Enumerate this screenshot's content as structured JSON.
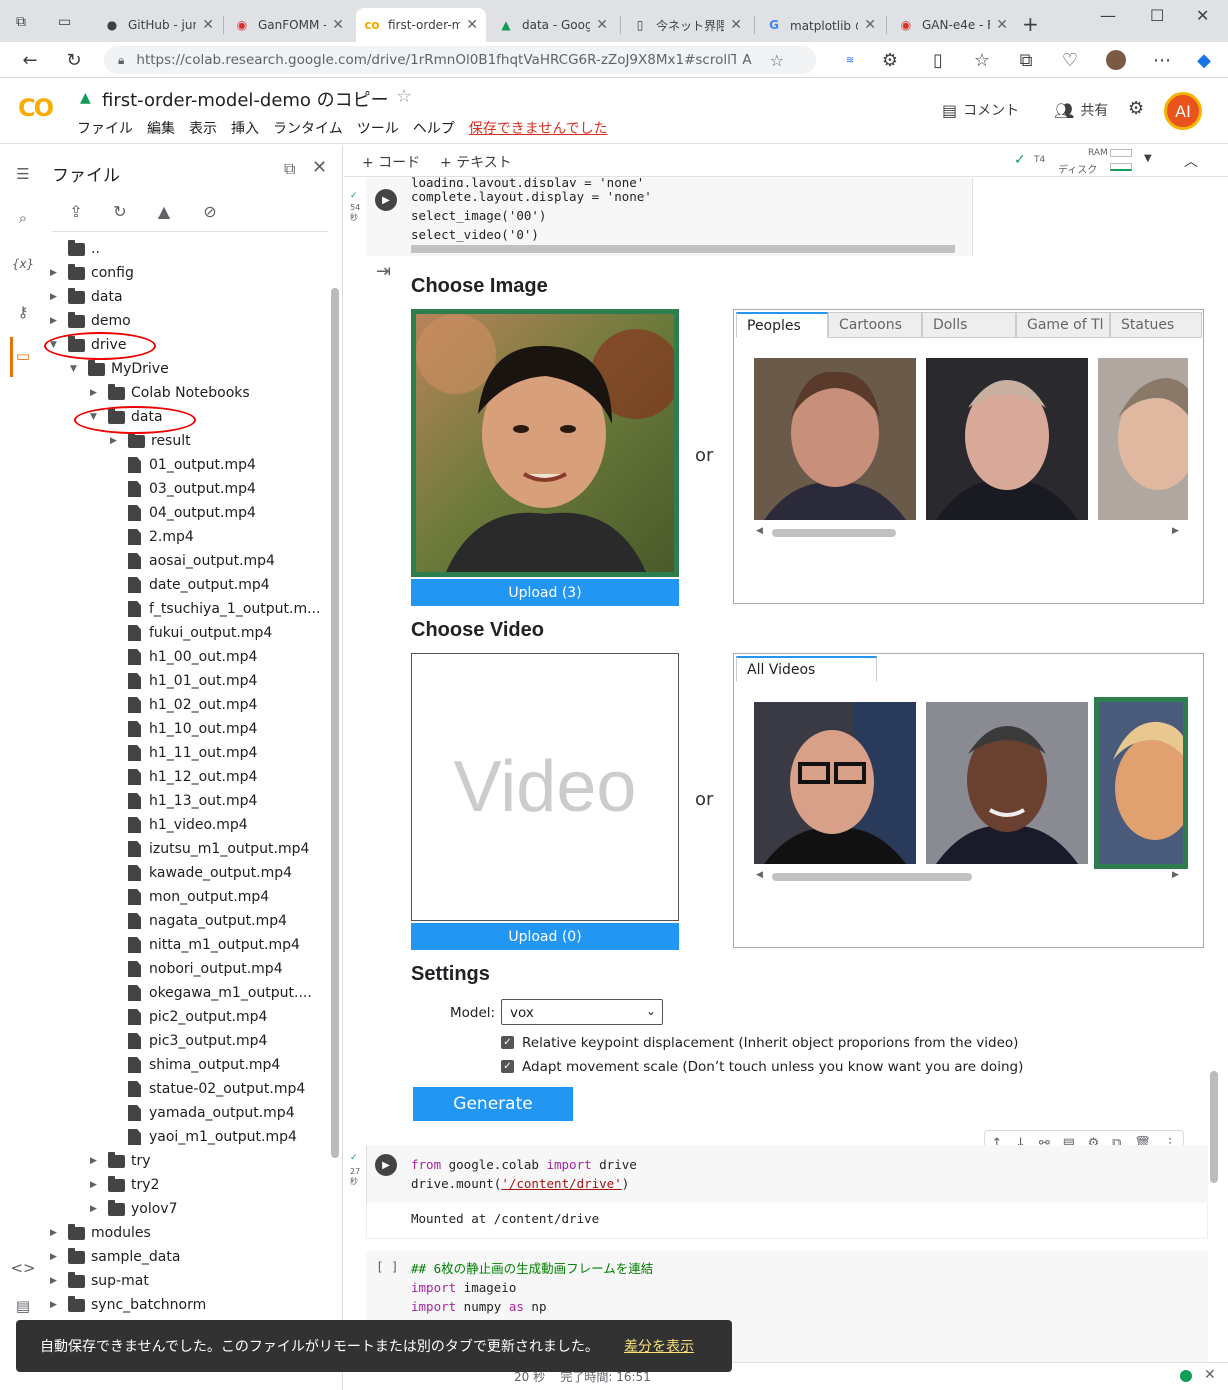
{
  "browser": {
    "tabs": [
      {
        "title": "GitHub - jun",
        "icon": "github-icon"
      },
      {
        "title": "GanFOMM -",
        "icon": "site-icon"
      },
      {
        "title": "first-order-m",
        "icon": "colab-icon",
        "active": true
      },
      {
        "title": "data - Googl",
        "icon": "drive-icon"
      },
      {
        "title": "今ネット界隈",
        "icon": "doc-icon"
      },
      {
        "title": "matplotlib の",
        "icon": "google-icon"
      },
      {
        "title": "GAN-e4e - F",
        "icon": "site-icon"
      }
    ],
    "url": "https://colab.research.google.com/drive/1rRmnOl0B1fhqtVaHRCG6R-zZoJ9X8Mx1#scrollTo=..."
  },
  "colab": {
    "logo": "CO",
    "title": "first-order-model-demo のコピー",
    "menu": [
      "ファイル",
      "編集",
      "表示",
      "挿入",
      "ランタイム",
      "ツール",
      "ヘルプ"
    ],
    "save_warning": "保存できませんでした",
    "comment_label": "コメント",
    "share_label": "共有",
    "avatar": "AI"
  },
  "files_panel": {
    "title": "ファイル",
    "tree": [
      {
        "label": "..",
        "type": "up",
        "depth": 0
      },
      {
        "label": "config",
        "type": "folder",
        "depth": 0,
        "expanded": false
      },
      {
        "label": "data",
        "type": "folder",
        "depth": 0,
        "expanded": false
      },
      {
        "label": "demo",
        "type": "folder",
        "depth": 0,
        "expanded": false
      },
      {
        "label": "drive",
        "type": "folder",
        "depth": 0,
        "expanded": true
      },
      {
        "label": "MyDrive",
        "type": "folder",
        "depth": 1,
        "expanded": true
      },
      {
        "label": "Colab Notebooks",
        "type": "folder",
        "depth": 2,
        "expanded": false
      },
      {
        "label": "data",
        "type": "folder",
        "depth": 2,
        "expanded": true
      },
      {
        "label": "result",
        "type": "folder",
        "depth": 3,
        "expanded": false
      },
      {
        "label": "01_output.mp4",
        "type": "file",
        "depth": 3
      },
      {
        "label": "03_output.mp4",
        "type": "file",
        "depth": 3
      },
      {
        "label": "04_output.mp4",
        "type": "file",
        "depth": 3
      },
      {
        "label": "2.mp4",
        "type": "file",
        "depth": 3
      },
      {
        "label": "aosai_output.mp4",
        "type": "file",
        "depth": 3
      },
      {
        "label": "date_output.mp4",
        "type": "file",
        "depth": 3
      },
      {
        "label": "f_tsuchiya_1_output.m...",
        "type": "file",
        "depth": 3
      },
      {
        "label": "fukui_output.mp4",
        "type": "file",
        "depth": 3
      },
      {
        "label": "h1_00_out.mp4",
        "type": "file",
        "depth": 3
      },
      {
        "label": "h1_01_out.mp4",
        "type": "file",
        "depth": 3
      },
      {
        "label": "h1_02_out.mp4",
        "type": "file",
        "depth": 3
      },
      {
        "label": "h1_10_out.mp4",
        "type": "file",
        "depth": 3
      },
      {
        "label": "h1_11_out.mp4",
        "type": "file",
        "depth": 3
      },
      {
        "label": "h1_12_out.mp4",
        "type": "file",
        "depth": 3
      },
      {
        "label": "h1_13_out.mp4",
        "type": "file",
        "depth": 3
      },
      {
        "label": "h1_video.mp4",
        "type": "file",
        "depth": 3
      },
      {
        "label": "izutsu_m1_output.mp4",
        "type": "file",
        "depth": 3
      },
      {
        "label": "kawade_output.mp4",
        "type": "file",
        "depth": 3
      },
      {
        "label": "mon_output.mp4",
        "type": "file",
        "depth": 3
      },
      {
        "label": "nagata_output.mp4",
        "type": "file",
        "depth": 3
      },
      {
        "label": "nitta_m1_output.mp4",
        "type": "file",
        "depth": 3
      },
      {
        "label": "nobori_output.mp4",
        "type": "file",
        "depth": 3
      },
      {
        "label": "okegawa_m1_output....",
        "type": "file",
        "depth": 3
      },
      {
        "label": "pic2_output.mp4",
        "type": "file",
        "depth": 3
      },
      {
        "label": "pic3_output.mp4",
        "type": "file",
        "depth": 3
      },
      {
        "label": "shima_output.mp4",
        "type": "file",
        "depth": 3
      },
      {
        "label": "statue-02_output.mp4",
        "type": "file",
        "depth": 3
      },
      {
        "label": "yamada_output.mp4",
        "type": "file",
        "depth": 3
      },
      {
        "label": "yaoi_m1_output.mp4",
        "type": "file",
        "depth": 3
      },
      {
        "label": "try",
        "type": "folder",
        "depth": 2,
        "expanded": false
      },
      {
        "label": "try2",
        "type": "folder",
        "depth": 2,
        "expanded": false
      },
      {
        "label": "yolov7",
        "type": "folder",
        "depth": 2,
        "expanded": false
      },
      {
        "label": "modules",
        "type": "folder",
        "depth": 0,
        "expanded": false
      },
      {
        "label": "sample_data",
        "type": "folder",
        "depth": 0,
        "expanded": false
      },
      {
        "label": "sup-mat",
        "type": "folder",
        "depth": 0,
        "expanded": false
      },
      {
        "label": "sync_batchnorm",
        "type": "folder",
        "depth": 0,
        "expanded": false
      }
    ]
  },
  "notebook": {
    "add_code": "+ コード",
    "add_text": "+ テキスト",
    "runtime": "T4",
    "ram_label": "RAM",
    "disk_label": "ディスク",
    "cell1": {
      "exec_time": "54\n秒",
      "lines": [
        "loading.layout.display = 'none'",
        "complete.layout.display = 'none'",
        "select_image('00')",
        "select_video('0')"
      ]
    },
    "widget": {
      "choose_image": "Choose Image",
      "upload_image": "Upload (3)",
      "or": "or",
      "image_tabs": [
        "Peoples",
        "Cartoons",
        "Dolls",
        "Game of Tl",
        "Statues"
      ],
      "choose_video": "Choose Video",
      "video_placeholder": "Video",
      "upload_video": "Upload (0)",
      "video_tabs": [
        "All Videos"
      ],
      "settings": "Settings",
      "model_label": "Model:",
      "model_value": "vox",
      "chk1": "Relative keypoint displacement (Inherit object proporions from the video)",
      "chk2": "Adapt movement scale (Don’t touch unless you know want you are doing)",
      "generate": "Generate"
    },
    "cell2": {
      "exec_time": "27\n秒",
      "line1_kw1": "from",
      "line1_mod": " google.colab ",
      "line1_kw2": "import",
      "line1_name": " drive",
      "line2_pre": "drive.mount(",
      "line2_str": "'/content/drive'",
      "line2_post": ")",
      "output": "Mounted at /content/drive"
    },
    "cell3": {
      "prompt": "[ ]",
      "comment": "## 6枚の静止画の生成動画フレームを連結",
      "import_kw": "import",
      "import1": " imageio",
      "import2": " numpy ",
      "as_kw": "as",
      "alias": " np"
    }
  },
  "toast": {
    "message": "自動保存できませんでした。このファイルがリモートまたは別のタブで更新されました。",
    "link": "差分を表示"
  },
  "status": {
    "text": "20 秒    完了時間: 16:51"
  }
}
